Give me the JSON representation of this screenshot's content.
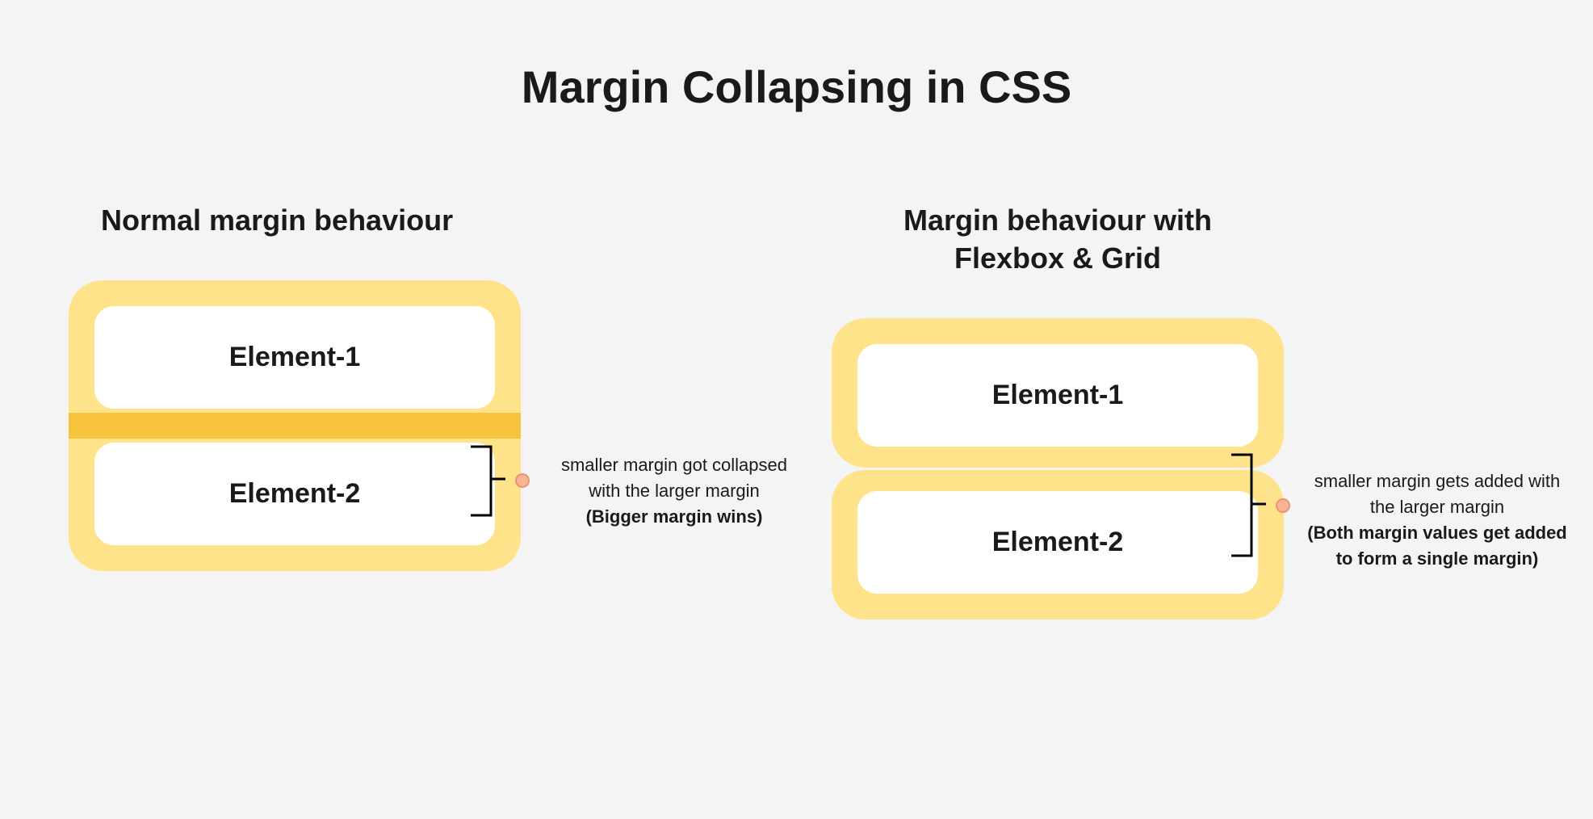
{
  "title": "Margin Collapsing in CSS",
  "left_section": {
    "title": "Normal margin behaviour",
    "element1": "Element-1",
    "element2": "Element-2",
    "annotation_line1": "smaller margin got collapsed",
    "annotation_line2": "with the larger margin",
    "annotation_bold": "(Bigger margin wins)"
  },
  "right_section": {
    "title_line1": "Margin behaviour with",
    "title_line2": "Flexbox & Grid",
    "element1": "Element-1",
    "element2": "Element-2",
    "annotation_line1": "smaller margin gets added with",
    "annotation_line2": "the larger margin",
    "annotation_bold_line1": "(Both margin values get added",
    "annotation_bold_line2": "to form a single margin)"
  }
}
